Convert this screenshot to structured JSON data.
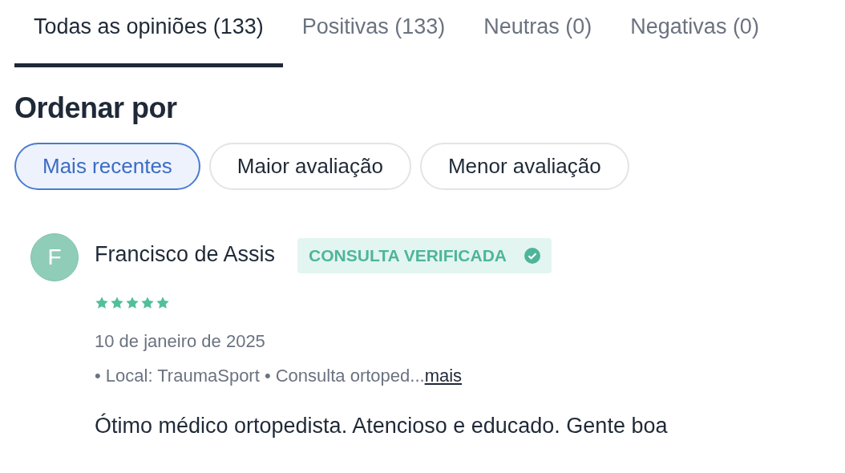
{
  "tabs": [
    {
      "label": "Todas as opiniões (133)",
      "selected": true
    },
    {
      "label": "Positivas (133)",
      "selected": false
    },
    {
      "label": "Neutras (0)",
      "selected": false
    },
    {
      "label": "Negativas (0)",
      "selected": false
    }
  ],
  "sort": {
    "title": "Ordenar por",
    "options": [
      {
        "label": "Mais recentes",
        "selected": true
      },
      {
        "label": "Maior avaliação",
        "selected": false
      },
      {
        "label": "Menor avaliação",
        "selected": false
      }
    ]
  },
  "reviews": [
    {
      "initial": "F",
      "author": "Francisco de Assis",
      "badge": "CONSULTA VERIFICADA",
      "stars": 5,
      "date": "10 de janeiro de 2025",
      "meta": "• Local: TraumaSport • Consulta ortoped...",
      "more": "mais",
      "text": "Ótimo médico ortopedista. Atencioso e educado. Gente boa"
    }
  ]
}
